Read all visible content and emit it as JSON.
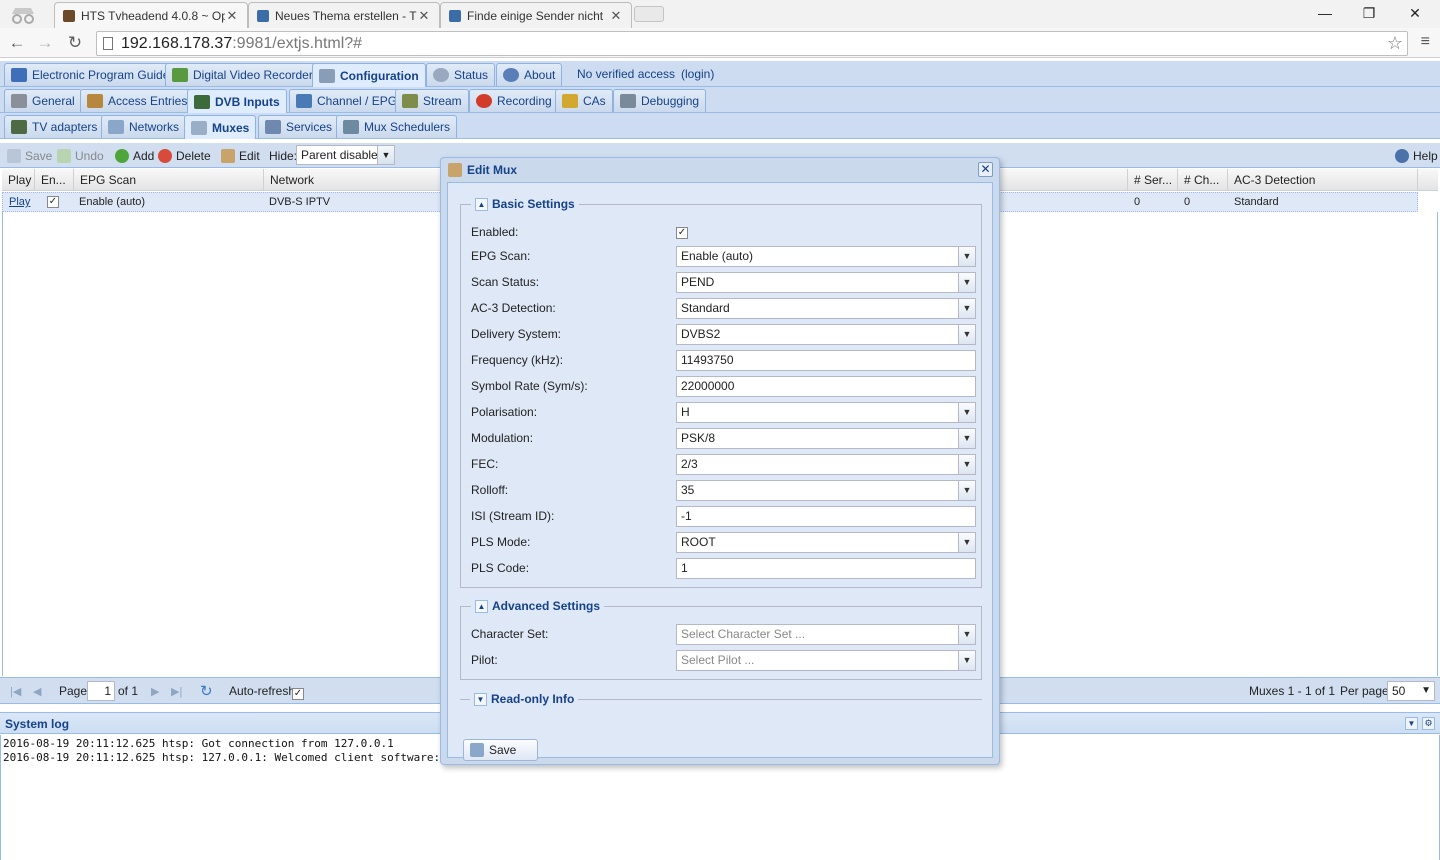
{
  "browser": {
    "tabs": [
      {
        "title": "HTS Tvheadend 4.0.8 ~ Op"
      },
      {
        "title": "Neues Thema erstellen - T"
      },
      {
        "title": "Finde einige Sender nicht"
      }
    ],
    "url_host": "192.168.178.37",
    "url_rest": ":9981/extjs.html?#"
  },
  "app": {
    "main_tabs": [
      "Electronic Program Guide",
      "Digital Video Recorder",
      "Configuration",
      "Status",
      "About"
    ],
    "access_text": "No verified access",
    "login_text": "(login)",
    "config_tabs": [
      "General",
      "Access Entries",
      "DVB Inputs",
      "Channel / EPG",
      "Stream",
      "Recording",
      "CAs",
      "Debugging"
    ],
    "dvb_tabs": [
      "TV adapters",
      "Networks",
      "Muxes",
      "Services",
      "Mux Schedulers"
    ],
    "toolbar": {
      "save": "Save",
      "undo": "Undo",
      "add": "Add",
      "delete": "Delete",
      "edit": "Edit",
      "hide_label": "Hide:",
      "hide_value": "Parent disabled",
      "help": "Help"
    },
    "grid": {
      "headers": [
        "Play",
        "En...",
        "EPG Scan",
        "Network",
        "# Ser...",
        "# Ch...",
        "AC-3 Detection"
      ],
      "row": {
        "play": "Play",
        "enabled": "✓",
        "epg_scan": "Enable (auto)",
        "network": "DVB-S IPTV",
        "services": "0",
        "channels": "0",
        "ac3": "Standard"
      }
    },
    "pager": {
      "page_label": "Page",
      "page_value": "1",
      "of_label": "of 1",
      "autorefresh": "Auto-refresh",
      "summary": "Muxes 1 - 1 of 1",
      "perpage_label": "Per page",
      "perpage_value": "50"
    },
    "syslog": {
      "title": "System log",
      "lines": [
        "2016-08-19 20:11:12.625 htsp: Got connection from 127.0.0.1",
        "2016-08-19 20:11:12.625 htsp: 127.0.0.1: Welcomed client software:"
      ]
    }
  },
  "dialog": {
    "title": "Edit Mux",
    "basic_legend": "Basic Settings",
    "fields": {
      "enabled": {
        "label": "Enabled:",
        "value": "✓"
      },
      "epg_scan": {
        "label": "EPG Scan:",
        "value": "Enable (auto)"
      },
      "scan_status": {
        "label": "Scan Status:",
        "value": "PEND"
      },
      "ac3": {
        "label": "AC-3 Detection:",
        "value": "Standard"
      },
      "delivery": {
        "label": "Delivery System:",
        "value": "DVBS2"
      },
      "frequency": {
        "label": "Frequency (kHz):",
        "value": "11493750"
      },
      "symbol_rate": {
        "label": "Symbol Rate (Sym/s):",
        "value": "22000000"
      },
      "polarisation": {
        "label": "Polarisation:",
        "value": "H"
      },
      "modulation": {
        "label": "Modulation:",
        "value": "PSK/8"
      },
      "fec": {
        "label": "FEC:",
        "value": "2/3"
      },
      "rolloff": {
        "label": "Rolloff:",
        "value": "35"
      },
      "isi": {
        "label": "ISI (Stream ID):",
        "value": "-1"
      },
      "pls_mode": {
        "label": "PLS Mode:",
        "value": "ROOT"
      },
      "pls_code": {
        "label": "PLS Code:",
        "value": "1"
      }
    },
    "advanced_legend": "Advanced Settings",
    "advanced": {
      "charset": {
        "label": "Character Set:",
        "placeholder": "Select Character Set ..."
      },
      "pilot": {
        "label": "Pilot:",
        "placeholder": "Select Pilot ..."
      }
    },
    "readonly_legend": "Read-only Info",
    "save": "Save"
  }
}
